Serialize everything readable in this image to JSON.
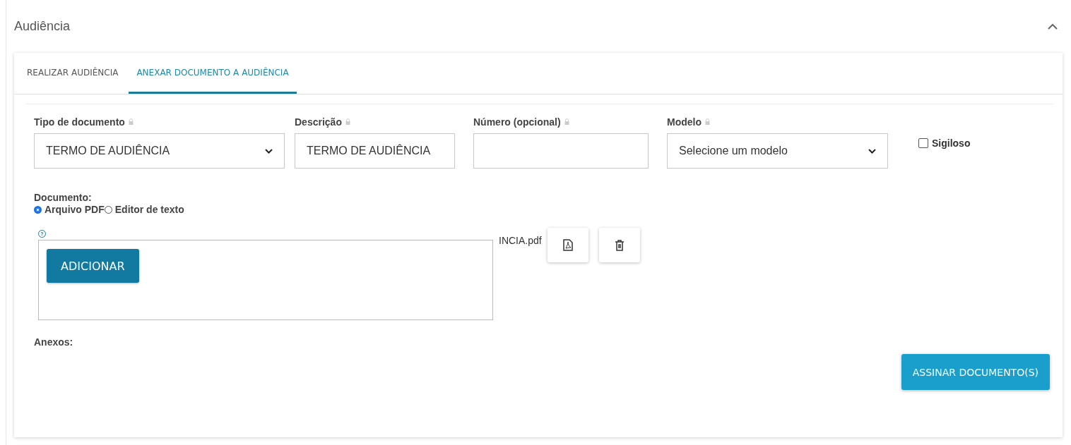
{
  "panel": {
    "title": "Audiência",
    "expanded": true
  },
  "tabs": [
    {
      "label": "REALIZAR AUDIÊNCIA",
      "selected": false
    },
    {
      "label": "ANEXAR DOCUMENTO A AUDIÊNCIA",
      "selected": true
    }
  ],
  "fields": [
    {
      "kind": "select",
      "label": "Tipo de documento",
      "value": "TERMO DE AUDIÊNCIA"
    },
    {
      "kind": "text",
      "label": "Descrição",
      "value": "TERMO DE AUDIÊNCIA"
    },
    {
      "kind": "text",
      "label": "Número (opcional)"
    },
    {
      "kind": "select",
      "label": "Modelo",
      "value": "Selecione um modelo"
    }
  ],
  "sigiloso": {
    "label": "Sigiloso",
    "checked": false
  },
  "documento": {
    "label": "Documento:",
    "options": [
      {
        "label": "Arquivo PDF",
        "selected": true
      },
      {
        "label": "Editor de texto",
        "selected": false
      }
    ]
  },
  "upload": {
    "help": "?",
    "button": "ADICIONAR",
    "file_name": "INCIA.pdf"
  },
  "anexos_label": "Anexos:",
  "sign_button": "ASSINAR DOCUMENTO(S)"
}
